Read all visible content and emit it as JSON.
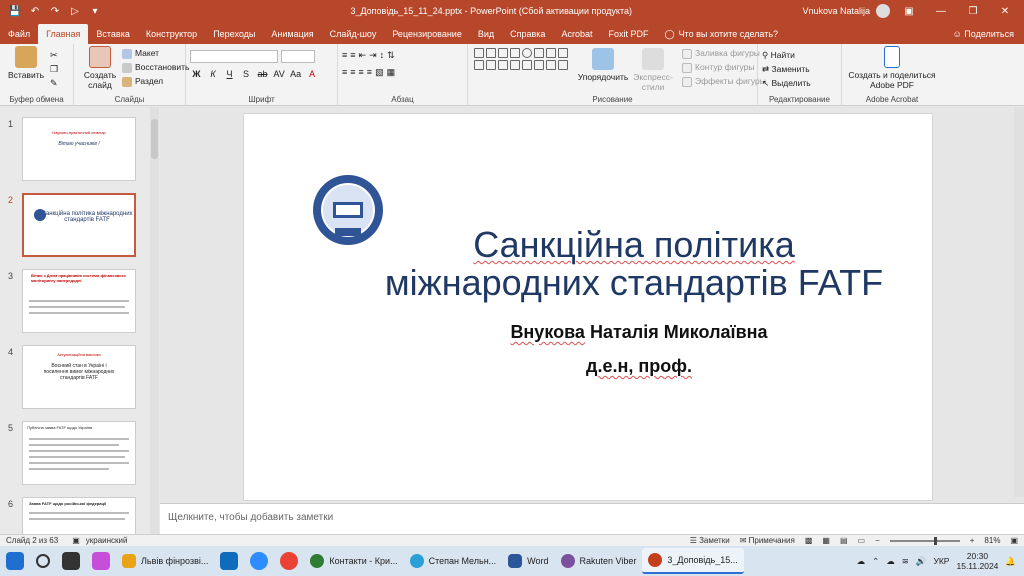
{
  "titlebar": {
    "filename": "3_Доповідь_15_11_24.pptx  -  PowerPoint (Сбой активации продукта)",
    "user": "Vnukova Natalija",
    "colors": {
      "bar": "#b7472a"
    }
  },
  "tabs": [
    "Файл",
    "Главная",
    "Вставка",
    "Конструктор",
    "Переходы",
    "Анимация",
    "Слайд-шоу",
    "Рецензирование",
    "Вид",
    "Справка",
    "Acrobat",
    "Foxit PDF"
  ],
  "tell_me": "Что вы хотите сделать?",
  "share": "Поделиться",
  "ribbon": {
    "clipboard": {
      "label": "Буфер обмена",
      "paste": "Вставить"
    },
    "slides": {
      "label": "Слайды",
      "new_slide": "Создать слайд",
      "layout": "Макет",
      "reset": "Восстановить",
      "section": "Раздел"
    },
    "font": {
      "label": "Шрифт",
      "buttons": [
        "Ж",
        "К",
        "Ч",
        "S",
        "ab",
        "AV",
        "Aa",
        "A"
      ]
    },
    "paragraph": {
      "label": "Абзац"
    },
    "drawing": {
      "label": "Рисование",
      "arrange": "Упорядочить",
      "quick_styles": "Экспресс-стили",
      "fill": "Заливка фигуры",
      "outline": "Контур фигуры",
      "effects": "Эффекты фигуры"
    },
    "editing": {
      "label": "Редактирование",
      "find": "Найти",
      "replace": "Заменить",
      "select": "Выделить"
    },
    "acrobat": {
      "label": "Adobe Acrobat",
      "create_share": "Создать и поделиться Adobe PDF"
    }
  },
  "thumbnails": [
    {
      "num": "1",
      "line1": "Науково-практичний семінар",
      "italic": "Вітаю учасників !"
    },
    {
      "num": "2",
      "italic": "Санкційна політика міжнародних стандартів FATF"
    },
    {
      "num": "3",
      "line1": "Вітаю з Днем працівників системи фінансового моніторингу напередодні"
    },
    {
      "num": "4",
      "line1": "Актуалізаційна виклики",
      "italic": "Воєнний стан в Україні і посилення вимог міжнародних стандартів FATF"
    },
    {
      "num": "5",
      "line1": "Публічна заява FATF щодо України"
    },
    {
      "num": "6",
      "line1": "Заява FATF щодо російської федерації"
    }
  ],
  "slide": {
    "title_line1": "Санкційна політика",
    "title_line2": "міжнародних стандартів FATF",
    "name_first": "Внукова",
    "name_rest": " Наталія Миколаївна",
    "degree": "д.е.н, проф."
  },
  "notes_placeholder": "Щелкните, чтобы добавить заметки",
  "status": {
    "slide_of": "Слайд 2 из 63",
    "language": "украинский",
    "notes_btn": "Заметки",
    "comments_btn": "Примечания",
    "zoom": "81%"
  },
  "taskbar": {
    "apps": [
      {
        "label": "Львів фінрозві...",
        "color": "#e8a317"
      },
      {
        "label": "Контакти - Кри...",
        "color": "#2e7d32"
      },
      {
        "label": "Степан Мельн...",
        "color": "#2b9fd8"
      },
      {
        "label": "Word",
        "color": "#2b579a"
      },
      {
        "label": "Rakuten Viber",
        "color": "#7b519d"
      },
      {
        "label": "3_Доповідь_15...",
        "color": "#c43e1c"
      }
    ],
    "lang": "УКР",
    "time": "20:30",
    "date": "15.11.2024"
  }
}
